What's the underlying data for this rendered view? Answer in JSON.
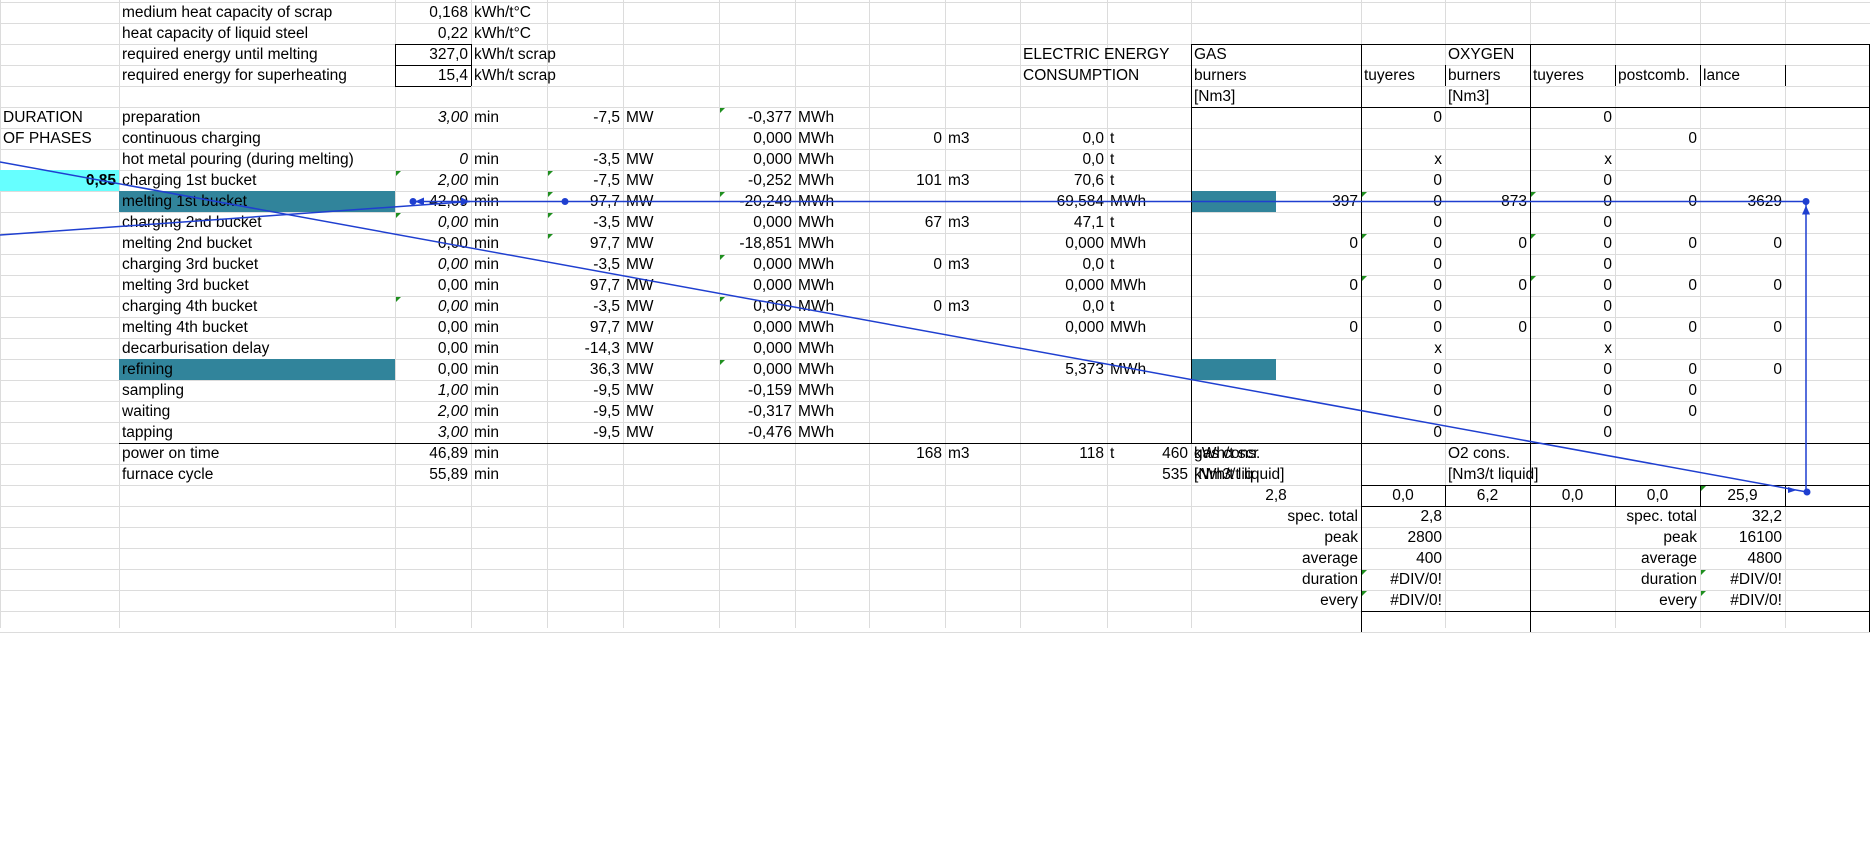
{
  "params": [
    {
      "label": "medium heat capacity of scrap",
      "value": "0,168",
      "unit": "kWh/t°C"
    },
    {
      "label": "heat capacity of liquid steel",
      "value": "0,22",
      "unit": "kWh/t°C"
    },
    {
      "label": "required energy until melting",
      "value": "327,0",
      "unit": "kWh/t scrap"
    },
    {
      "label": "required energy for superheating",
      "value": "15,4",
      "unit": "kWh/t scrap"
    }
  ],
  "section": {
    "line1": "DURATION",
    "line2": "OF PHASES",
    "input_value": "0,85"
  },
  "phases": [
    {
      "name": "preparation",
      "duration": "3,00",
      "dur_unit": "min",
      "power": "-7,5",
      "power_unit": "MW",
      "energy": "-0,377",
      "energy_unit": "MWh",
      "vol": "",
      "vol_unit": "",
      "mass": "",
      "mass_unit": "",
      "elec": "",
      "elec_unit": "",
      "g1": "",
      "g2": "0",
      "o1": "",
      "o2": "0",
      "o3": "",
      "o4": ""
    },
    {
      "name": "continuous charging",
      "duration": "",
      "dur_unit": "",
      "power": "",
      "power_unit": "",
      "energy": "0,000",
      "energy_unit": "MWh",
      "vol": "0",
      "vol_unit": "m3",
      "mass": "0,0",
      "mass_unit": "t",
      "elec": "",
      "elec_unit": "",
      "g1": "",
      "g2": "",
      "o1": "",
      "o2": "",
      "o3": "0",
      "o4": ""
    },
    {
      "name": "hot metal pouring (during melting)",
      "duration": "0",
      "dur_unit": "min",
      "power": "-3,5",
      "power_unit": "MW",
      "energy": "0,000",
      "energy_unit": "MWh",
      "vol": "",
      "vol_unit": "",
      "mass": "0,0",
      "mass_unit": "t",
      "elec": "",
      "elec_unit": "",
      "g1": "",
      "g2": "x",
      "o1": "",
      "o2": "x",
      "o3": "",
      "o4": ""
    },
    {
      "name": "charging 1st bucket",
      "duration": "2,00",
      "dur_unit": "min",
      "power": "-7,5",
      "power_unit": "MW",
      "energy": "-0,252",
      "energy_unit": "MWh",
      "vol": "101",
      "vol_unit": "m3",
      "mass": "70,6",
      "mass_unit": "t",
      "elec": "",
      "elec_unit": "",
      "g1": "",
      "g2": "0",
      "o1": "",
      "o2": "0",
      "o3": "",
      "o4": ""
    },
    {
      "name": "melting 1st bucket",
      "duration": "42,09",
      "dur_unit": "min",
      "power": "97,7",
      "power_unit": "MW",
      "energy": "-20,249",
      "energy_unit": "MWh",
      "vol": "",
      "vol_unit": "",
      "mass": "",
      "mass_unit": "",
      "elec": "69,584",
      "elec_unit": "MWh",
      "g1": "397",
      "g2": "0",
      "o1": "873",
      "o2": "0",
      "o3": "0",
      "o4": "3629"
    },
    {
      "name": "charging 2nd bucket",
      "duration": "0,00",
      "dur_unit": "min",
      "power": "-3,5",
      "power_unit": "MW",
      "energy": "0,000",
      "energy_unit": "MWh",
      "vol": "67",
      "vol_unit": "m3",
      "mass": "47,1",
      "mass_unit": "t",
      "elec": "",
      "elec_unit": "",
      "g1": "",
      "g2": "0",
      "o1": "",
      "o2": "0",
      "o3": "",
      "o4": ""
    },
    {
      "name": "melting 2nd bucket",
      "duration": "0,00",
      "dur_unit": "min",
      "power": "97,7",
      "power_unit": "MW",
      "energy": "-18,851",
      "energy_unit": "MWh",
      "vol": "",
      "vol_unit": "",
      "mass": "",
      "mass_unit": "",
      "elec": "0,000",
      "elec_unit": "MWh",
      "g1": "0",
      "g2": "0",
      "o1": "0",
      "o2": "0",
      "o3": "0",
      "o4": "0"
    },
    {
      "name": "charging 3rd bucket",
      "duration": "0,00",
      "dur_unit": "min",
      "power": "-3,5",
      "power_unit": "MW",
      "energy": "0,000",
      "energy_unit": "MWh",
      "vol": "0",
      "vol_unit": "m3",
      "mass": "0,0",
      "mass_unit": "t",
      "elec": "",
      "elec_unit": "",
      "g1": "",
      "g2": "0",
      "o1": "",
      "o2": "0",
      "o3": "",
      "o4": ""
    },
    {
      "name": "melting 3rd bucket",
      "duration": "0,00",
      "dur_unit": "min",
      "power": "97,7",
      "power_unit": "MW",
      "energy": "0,000",
      "energy_unit": "MWh",
      "vol": "",
      "vol_unit": "",
      "mass": "",
      "mass_unit": "",
      "elec": "0,000",
      "elec_unit": "MWh",
      "g1": "0",
      "g2": "0",
      "o1": "0",
      "o2": "0",
      "o3": "0",
      "o4": "0"
    },
    {
      "name": "charging 4th bucket",
      "duration": "0,00",
      "dur_unit": "min",
      "power": "-3,5",
      "power_unit": "MW",
      "energy": "0,000",
      "energy_unit": "MWh",
      "vol": "0",
      "vol_unit": "m3",
      "mass": "0,0",
      "mass_unit": "t",
      "elec": "",
      "elec_unit": "",
      "g1": "",
      "g2": "0",
      "o1": "",
      "o2": "0",
      "o3": "",
      "o4": ""
    },
    {
      "name": "melting 4th bucket",
      "duration": "0,00",
      "dur_unit": "min",
      "power": "97,7",
      "power_unit": "MW",
      "energy": "0,000",
      "energy_unit": "MWh",
      "vol": "",
      "vol_unit": "",
      "mass": "",
      "mass_unit": "",
      "elec": "0,000",
      "elec_unit": "MWh",
      "g1": "0",
      "g2": "0",
      "o1": "0",
      "o2": "0",
      "o3": "0",
      "o4": "0"
    },
    {
      "name": "decarburisation delay",
      "duration": "0,00",
      "dur_unit": "min",
      "power": "-14,3",
      "power_unit": "MW",
      "energy": "0,000",
      "energy_unit": "MWh",
      "vol": "",
      "vol_unit": "",
      "mass": "",
      "mass_unit": "",
      "elec": "",
      "elec_unit": "",
      "g1": "",
      "g2": "x",
      "o1": "",
      "o2": "x",
      "o3": "",
      "o4": ""
    },
    {
      "name": "refining",
      "duration": "0,00",
      "dur_unit": "min",
      "power": "36,3",
      "power_unit": "MW",
      "energy": "0,000",
      "energy_unit": "MWh",
      "vol": "",
      "vol_unit": "",
      "mass": "",
      "mass_unit": "",
      "elec": "5,373",
      "elec_unit": "MWh",
      "g1": "",
      "g2": "0",
      "o1": "",
      "o2": "0",
      "o3": "0",
      "o4": "0"
    },
    {
      "name": "sampling",
      "duration": "1,00",
      "dur_unit": "min",
      "power": "-9,5",
      "power_unit": "MW",
      "energy": "-0,159",
      "energy_unit": "MWh",
      "vol": "",
      "vol_unit": "",
      "mass": "",
      "mass_unit": "",
      "elec": "",
      "elec_unit": "",
      "g1": "",
      "g2": "0",
      "o1": "",
      "o2": "0",
      "o3": "0",
      "o4": ""
    },
    {
      "name": "waiting",
      "duration": "2,00",
      "dur_unit": "min",
      "power": "-9,5",
      "power_unit": "MW",
      "energy": "-0,317",
      "energy_unit": "MWh",
      "vol": "",
      "vol_unit": "",
      "mass": "",
      "mass_unit": "",
      "elec": "",
      "elec_unit": "",
      "g1": "",
      "g2": "0",
      "o1": "",
      "o2": "0",
      "o3": "0",
      "o4": ""
    },
    {
      "name": "tapping",
      "duration": "3,00",
      "dur_unit": "min",
      "power": "-9,5",
      "power_unit": "MW",
      "energy": "-0,476",
      "energy_unit": "MWh",
      "vol": "",
      "vol_unit": "",
      "mass": "",
      "mass_unit": "",
      "elec": "",
      "elec_unit": "",
      "g1": "",
      "g2": "0",
      "o1": "",
      "o2": "0",
      "o3": "",
      "o4": ""
    }
  ],
  "totals": [
    {
      "label": "power on time",
      "value": "46,89",
      "unit": "min",
      "vol": "168",
      "vol_unit": "m3",
      "mass": "118",
      "mass_unit": "t",
      "elec": "460",
      "elec_unit": "kWh/t scr"
    },
    {
      "label": "furnace cycle",
      "value": "55,89",
      "unit": "min",
      "vol": "",
      "vol_unit": "",
      "mass": "",
      "mass_unit": "",
      "elec": "535",
      "elec_unit": "kWh/t liq"
    }
  ],
  "headers": {
    "electric_l1": "ELECTRIC ENERGY",
    "electric_l2": "CONSUMPTION",
    "gas": "GAS",
    "oxygen": "OXYGEN",
    "burners": "burners",
    "tuyeres": "tuyeres",
    "postcomb": "postcomb.",
    "lance": "lance",
    "nm3": "[Nm3]"
  },
  "gas_summary": {
    "title": "gas cons.",
    "unit": "[Nm3/t liquid]",
    "v1": "2,8",
    "v2": "0,0",
    "stats": [
      {
        "label": "spec. total",
        "value": "2,8"
      },
      {
        "label": "peak",
        "value": "2800"
      },
      {
        "label": "average",
        "value": "400"
      },
      {
        "label": "duration",
        "value": "#DIV/0!"
      },
      {
        "label": "every",
        "value": "#DIV/0!"
      }
    ]
  },
  "o2_summary": {
    "title": "O2 cons.",
    "unit": "[Nm3/t liquid]",
    "v1": "6,2",
    "v2": "0,0",
    "v3": "0,0",
    "v4": "25,9",
    "stats": [
      {
        "label": "spec. total",
        "value": "32,2"
      },
      {
        "label": "peak",
        "value": "16100"
      },
      {
        "label": "average",
        "value": "4800"
      },
      {
        "label": "duration",
        "value": "#DIV/0!"
      },
      {
        "label": "every",
        "value": "#DIV/0!"
      }
    ]
  },
  "colors": {
    "highlight_teal": "#31849b",
    "input_cyan": "#66ffff",
    "arrow_blue": "#1f3fd0",
    "grid": "#dcdcdc"
  }
}
